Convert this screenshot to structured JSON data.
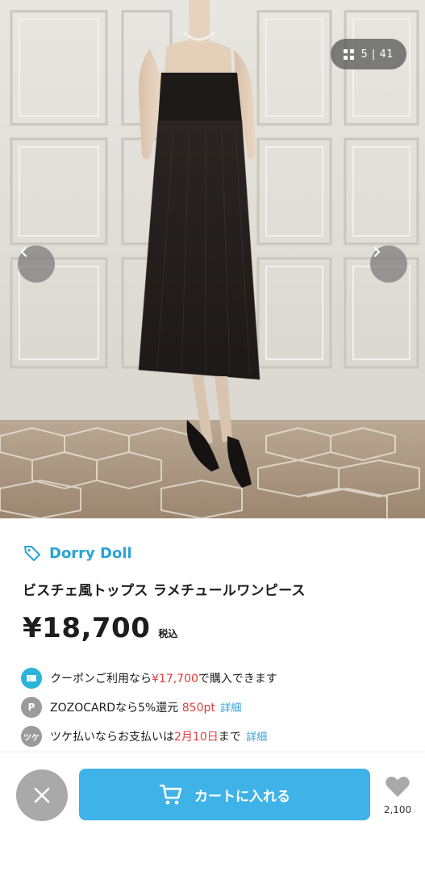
{
  "gallery": {
    "counter": "5 | 41",
    "icons": {
      "grid": "grid-icon",
      "prev": "chevron-left-icon",
      "next": "chevron-right-icon"
    }
  },
  "product": {
    "brand": "Dorry Doll",
    "title": "ビスチェ風トップス ラメチュールワンピース",
    "price": "¥18,700",
    "tax_label": "税込"
  },
  "perks": {
    "coupon": {
      "prefix": "クーポンご利用なら",
      "price": "¥17,700",
      "suffix": "で購入できます",
      "color": "#2bb3d8"
    },
    "zozocard": {
      "badge": "P",
      "prefix": "ZOZOCARDなら5%還元",
      "points": "850pt",
      "link": "詳細"
    },
    "tsuke": {
      "badge": "ツケ",
      "prefix": "ツケ払いならお支払いは",
      "date": "2月10日",
      "suffix": "まで",
      "link": "詳細"
    }
  },
  "actions": {
    "cart_label": "カートに入れる",
    "favorite_count": "2,100"
  },
  "colors": {
    "accent": "#3fb3e8",
    "brand": "#2aa3d6",
    "highlight": "#e23c3c"
  }
}
